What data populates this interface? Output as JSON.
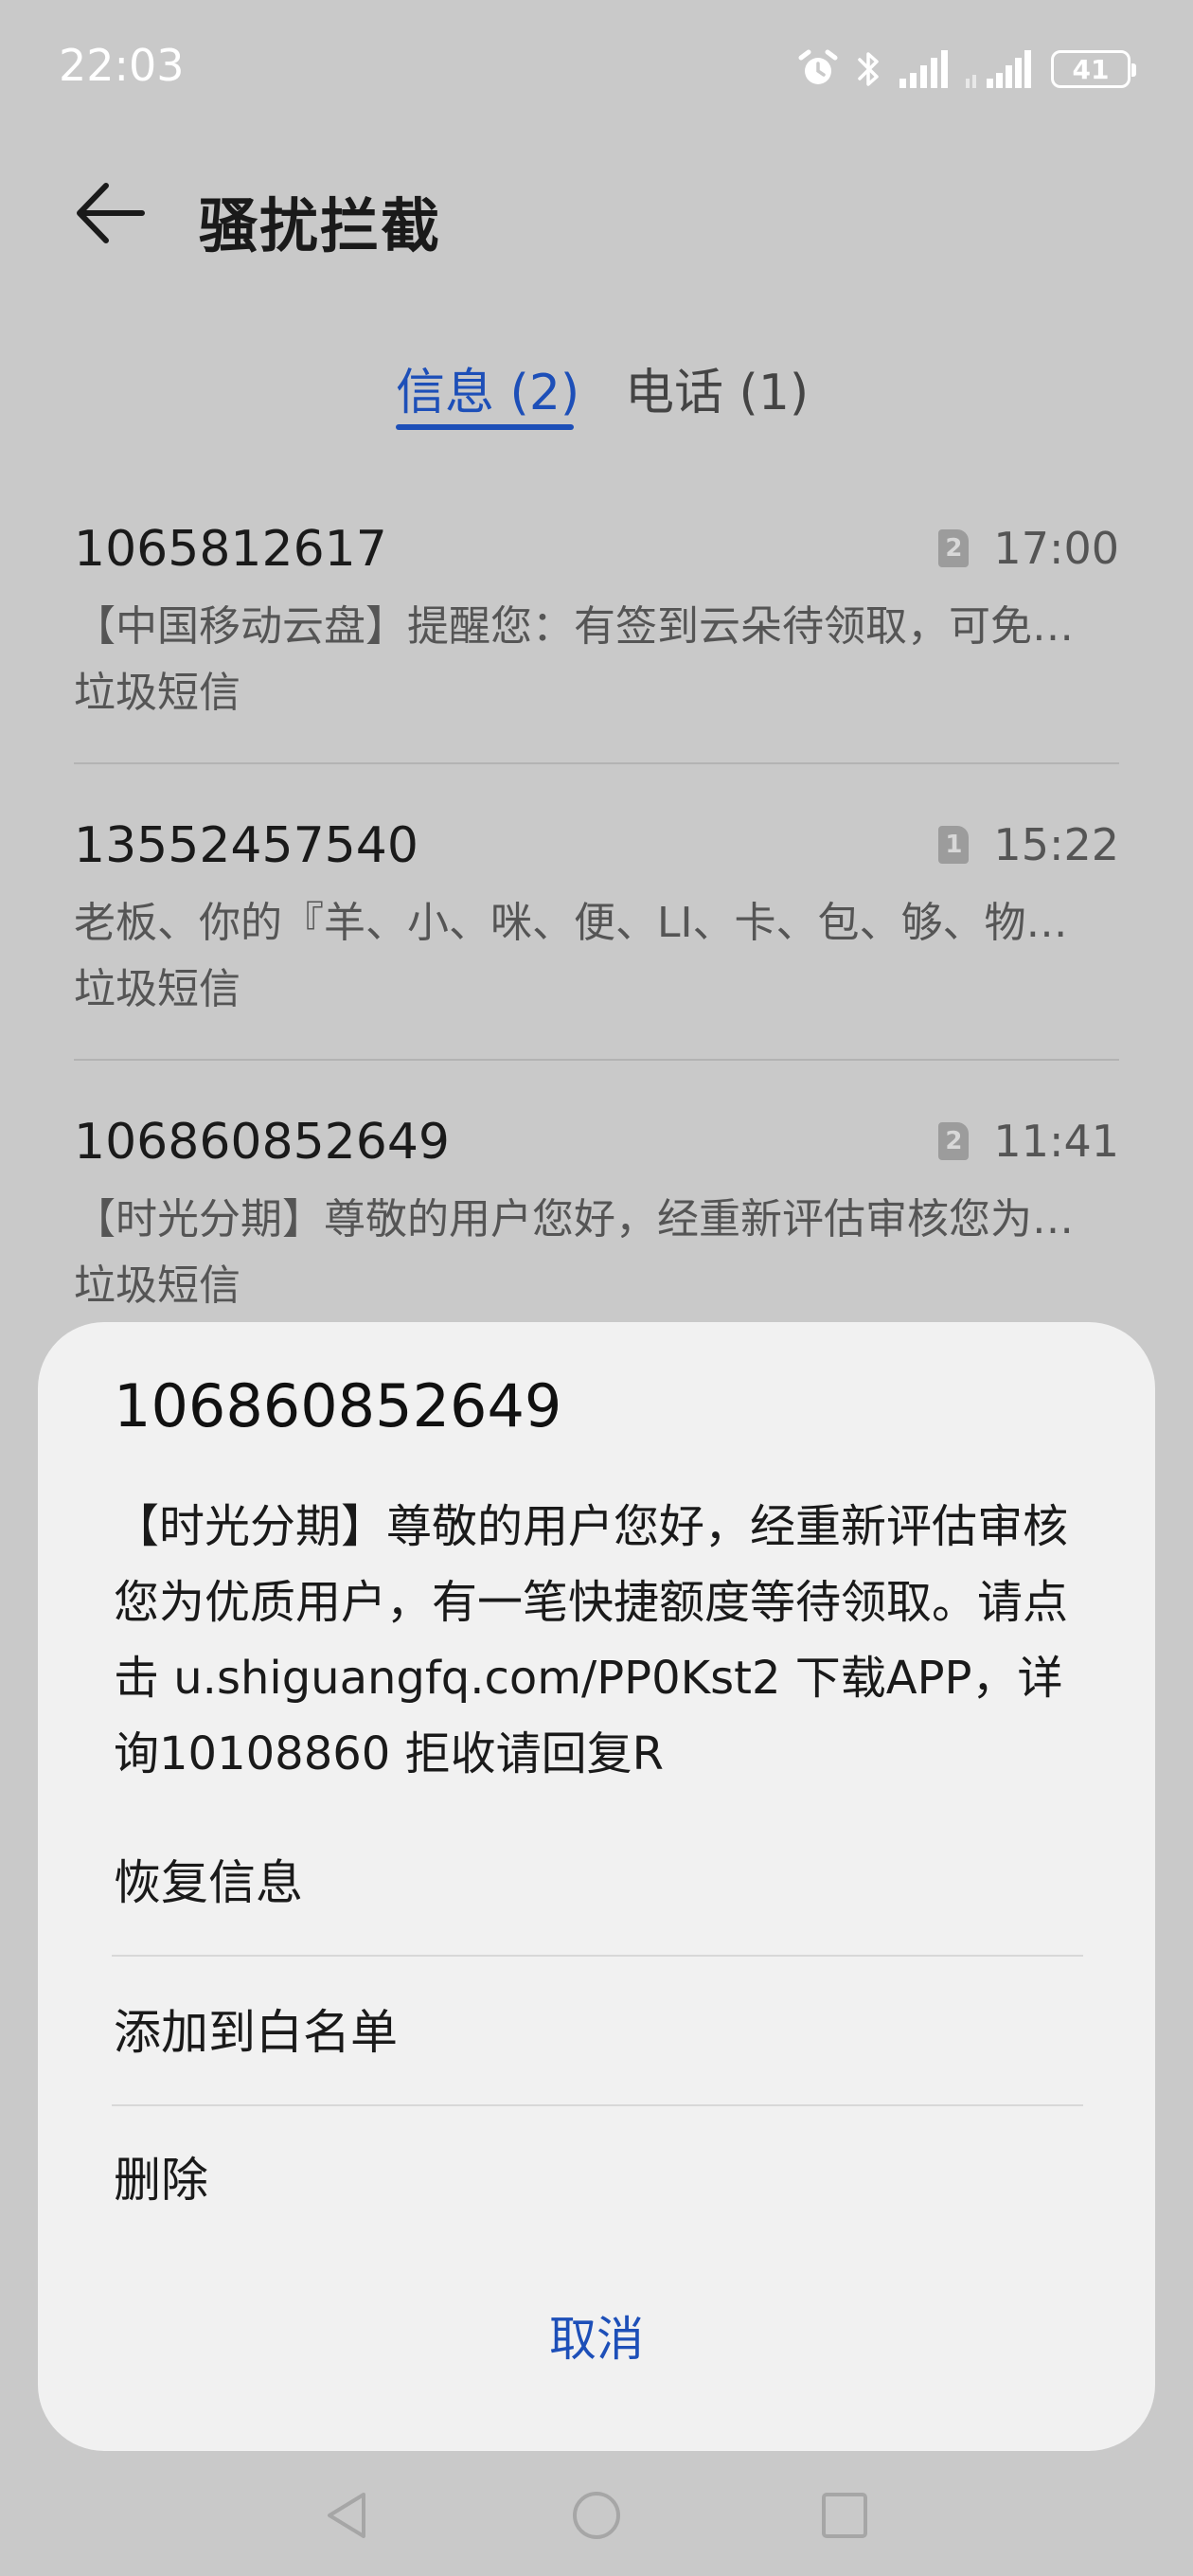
{
  "status_bar": {
    "time": "22:03",
    "battery": "41",
    "icons": [
      "alarm-icon",
      "bluetooth-icon",
      "signal-icon",
      "signal-icon-secondary",
      "battery-icon"
    ]
  },
  "header": {
    "title": "骚扰拦截",
    "back_icon": "arrow-left-icon"
  },
  "tabs": [
    {
      "label": "信息 (2)",
      "active": true
    },
    {
      "label": "电话 (1)",
      "active": false
    }
  ],
  "messages": [
    {
      "number": "1065812617",
      "sim": "2",
      "time": "17:00",
      "preview": "【中国移动云盘】提醒您：有签到云朵待领取，可免…",
      "tag": "垃圾短信"
    },
    {
      "number": "13552457540",
      "sim": "1",
      "time": "15:22",
      "preview": "老板、你的『羊、小、咪、便、LI、卡、包、够、物…",
      "tag": "垃圾短信"
    },
    {
      "number": "106860852649",
      "sim": "2",
      "time": "11:41",
      "preview": "【时光分期】尊敬的用户您好，经重新评估审核您为…",
      "tag": "垃圾短信"
    }
  ],
  "sheet": {
    "number": "106860852649",
    "body": "【时光分期】尊敬的用户您好，经重新评估审核您为优质用户，有一笔快捷额度等待领取。请点击 u.shiguangfq.com/PP0Kst2 下载APP，详询10108860 拒收请回复R",
    "actions": {
      "restore": "恢复信息",
      "whitelist": "添加到白名单",
      "delete": "删除"
    },
    "cancel": "取消"
  },
  "colors": {
    "accent": "#1d4fb8",
    "overlay_background": "#c9c9c9",
    "sheet_background": "#f1f1f1"
  }
}
